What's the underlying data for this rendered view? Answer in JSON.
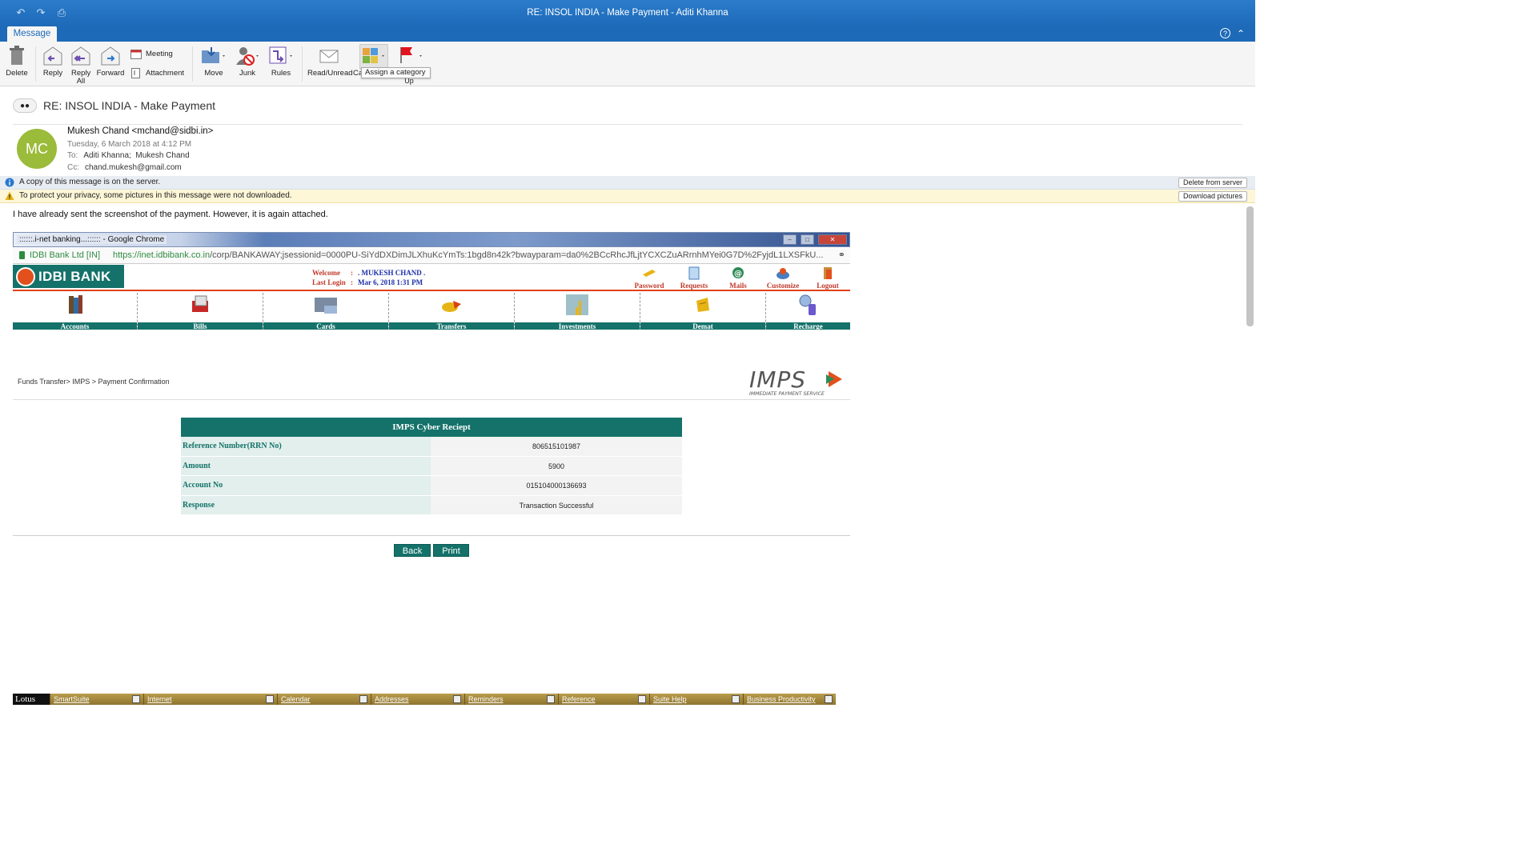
{
  "window": {
    "title": "RE: INSOL INDIA - Make Payment - Aditi Khanna"
  },
  "tabs": {
    "message": "Message"
  },
  "ribbon": {
    "delete": "Delete",
    "reply": "Reply",
    "reply_all": "Reply All",
    "forward": "Forward",
    "meeting": "Meeting",
    "attachment": "Attachment",
    "move": "Move",
    "junk": "Junk",
    "rules": "Rules",
    "read_unread": "Read/Unread",
    "categorize_partial": "Ca",
    "follow_up_partial": "Up",
    "tooltip": "Assign a category"
  },
  "email": {
    "subject": "RE: INSOL INDIA - Make Payment",
    "avatar_initials": "MC",
    "sender": "Mukesh Chand <mchand@sidbi.in>",
    "date": "Tuesday, 6 March 2018 at 4:12 PM",
    "to_label": "To:",
    "to": "Aditi Khanna;  Mukesh Chand",
    "cc_label": "Cc:",
    "cc": "chand.mukesh@gmail.com",
    "info_bar": "A copy of this message is on the server.",
    "info_button": "Delete from server",
    "warn_bar": "To protect your privacy, some pictures in this message were not downloaded.",
    "warn_button": "Download pictures",
    "body": "I have already sent the screenshot of the payment. However, it is again attached."
  },
  "screenshot": {
    "browser_title": "::::::.i-net banking...:::::: - Google Chrome",
    "site_name": "IDBI Bank Ltd [IN]",
    "url_host": "https://inet.idbibank.co.in",
    "url_rest": "/corp/BANKAWAY;jsessionid=0000PU-SiYdDXDimJLXhuKcYmTs:1bgd8n42k?bwayparam=da0%2BCcRhcJfLjtYCXCZuARrnhMYei0G7D%2FyjdL1LXSFkU...",
    "bank_name": "IDBI BANK",
    "welcome_label": "Welcome",
    "welcome_value": ". MUKESH CHAND .",
    "last_login_label": "Last Login",
    "last_login_value": "Mar 6, 2018 1:31 PM",
    "top_links": [
      "Password",
      "Requests",
      "Mails",
      "Customize",
      "Logout"
    ],
    "menu": [
      "Accounts",
      "Bills",
      "Cards",
      "Transfers",
      "Investments",
      "Demat",
      "Recharge"
    ],
    "breadcrumb": "Funds Transfer> IMPS > Payment Confirmation",
    "imps_logo_text": "IMPS",
    "imps_logo_sub": "IMMEDIATE PAYMENT SERVICE",
    "receipt_title": "IMPS Cyber Reciept",
    "receipt_rows": [
      {
        "label": "Reference Number(RRN No)",
        "value": "806515101987"
      },
      {
        "label": "Amount",
        "value": "5900"
      },
      {
        "label": "Account No",
        "value": "015104000136693"
      },
      {
        "label": "Response",
        "value": "Transaction Successful"
      }
    ],
    "back": "Back",
    "print": "Print",
    "taskbar": {
      "brand": "Lotus",
      "items": [
        "SmartSuite",
        "Internet",
        "Calendar",
        "Addresses",
        "Reminders",
        "Reference",
        "Suite Help",
        "Business Productivity"
      ]
    }
  },
  "colors": {
    "title_blue": "#1d6ab8",
    "bank_green": "#14726a",
    "bank_orange": "#e2501c",
    "avatar_green": "#9bbb3a"
  }
}
